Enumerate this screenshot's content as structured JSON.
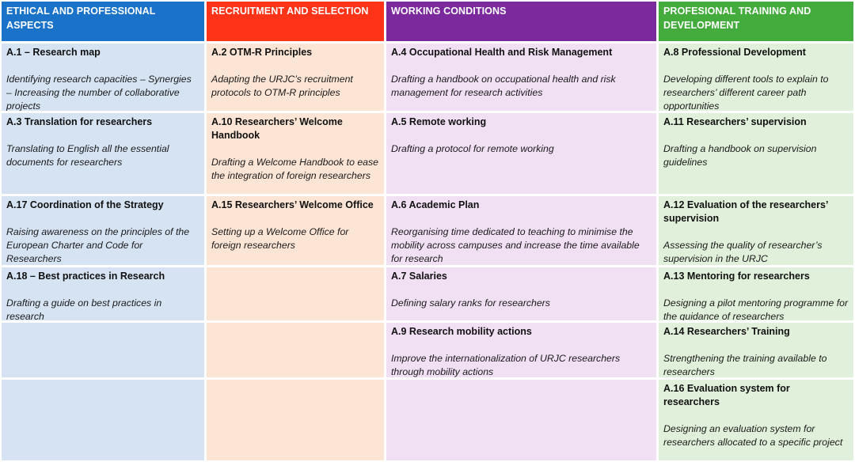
{
  "colors": {
    "ethical_header": "#1a73c8",
    "recruitment_header": "#ff3318",
    "working_header": "#7b2a9e",
    "training_header": "#43ac3c",
    "ethical_cell": "#d5e3f3",
    "recruitment_cell": "#fde5d6",
    "working_cell": "#f1dff4",
    "training_cell": "#e0f0da"
  },
  "columns": [
    {
      "header": "ETHICAL AND PROFESSIONAL ASPECTS",
      "cells": [
        {
          "title": "A.1 – Research map",
          "desc": "Identifying research capacities – Synergies – Increasing the number of collaborative projects"
        },
        {
          "title": "A.3 Translation for researchers",
          "desc": "Translating to English all the essential documents for researchers"
        },
        {
          "title": "A.17 Coordination of the Strategy",
          "desc": "Raising awareness on the principles of the European Charter and Code for Researchers"
        },
        {
          "title": "A.18 – Best practices in Research",
          "desc": "Drafting a guide on best practices in research"
        },
        {
          "title": "",
          "desc": ""
        },
        {
          "title": "",
          "desc": ""
        }
      ]
    },
    {
      "header": "RECRUITMENT AND SELECTION",
      "cells": [
        {
          "title": "A.2 OTM-R Principles",
          "desc": "Adapting the URJC’s recruitment protocols to OTM-R principles"
        },
        {
          "title": "A.10 Researchers’ Welcome Handbook",
          "desc": "Drafting a Welcome Handbook to ease the integration of foreign researchers"
        },
        {
          "title": "A.15 Researchers’ Welcome Office",
          "desc": "Setting up a Welcome Office for foreign researchers"
        },
        {
          "title": "",
          "desc": ""
        },
        {
          "title": "",
          "desc": ""
        },
        {
          "title": "",
          "desc": ""
        }
      ]
    },
    {
      "header": "WORKING CONDITIONS",
      "cells": [
        {
          "title": "A.4 Occupational Health and Risk Management",
          "desc": "Drafting a handbook on occupational health and risk management for research activities"
        },
        {
          "title": "A.5 Remote working",
          "desc": "Drafting a protocol for remote working"
        },
        {
          "title": "A.6 Academic Plan",
          "desc": "Reorganising time dedicated to teaching to minimise the mobility across campuses and increase the time available for research"
        },
        {
          "title": "A.7 Salaries",
          "desc": "Defining salary ranks for researchers"
        },
        {
          "title": "A.9 Research mobility actions",
          "desc": "Improve the internationalization of URJC researchers through mobility actions"
        },
        {
          "title": "",
          "desc": ""
        }
      ]
    },
    {
      "header": "PROFESIONAL TRAINING AND DEVELOPMENT",
      "cells": [
        {
          "title": "A.8 Professional Development",
          "desc": "Developing different tools to explain to researchers’ different career path opportunities"
        },
        {
          "title": "A.11 Researchers’ supervision",
          "desc": "Drafting a handbook on supervision guidelines"
        },
        {
          "title": "A.12 Evaluation of the researchers’ supervision",
          "desc": "Assessing the quality of researcher’s supervision in the URJC"
        },
        {
          "title": "A.13 Mentoring for researchers",
          "desc": "Designing a pilot mentoring programme for the guidance of researchers"
        },
        {
          "title": "A.14 Researchers’ Training",
          "desc": "Strengthening the training available to researchers"
        },
        {
          "title": "A.16 Evaluation system for researchers",
          "desc": "Designing an evaluation system for researchers allocated to a specific project"
        }
      ]
    }
  ]
}
